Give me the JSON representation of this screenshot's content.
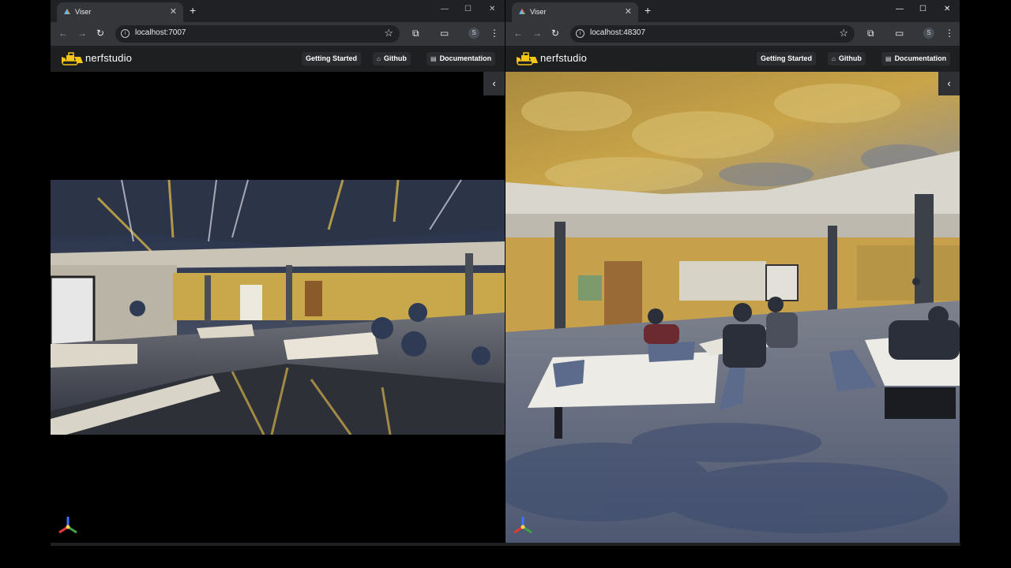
{
  "windows": [
    {
      "tab_title": "Viser",
      "url": "localhost:7007",
      "app": {
        "brand": "nerfstudio",
        "nav": [
          "Getting Started",
          "Github",
          "Documentation"
        ]
      }
    },
    {
      "tab_title": "Viser",
      "url": "localhost:48307",
      "app": {
        "brand": "nerfstudio",
        "nav": [
          "Getting Started",
          "Github",
          "Documentation"
        ]
      }
    }
  ],
  "icons": {
    "favicon": "viser-favicon-icon",
    "tab_close": "close-icon",
    "new_tab": "plus-icon",
    "back": "back-arrow-icon",
    "forward": "forward-arrow-icon",
    "reload": "reload-icon",
    "site_info": "info-icon",
    "bookmark": "star-icon",
    "extensions": "puzzle-icon",
    "cast": "cast-icon",
    "profile": "S",
    "menu": "kebab-menu-icon",
    "collapse": "chevron-left-icon"
  },
  "colors": {
    "chrome_dark": "#202124",
    "toolbar": "#35363a",
    "app_header": "#1e1f21",
    "logo_yellow": "#f5c518"
  }
}
